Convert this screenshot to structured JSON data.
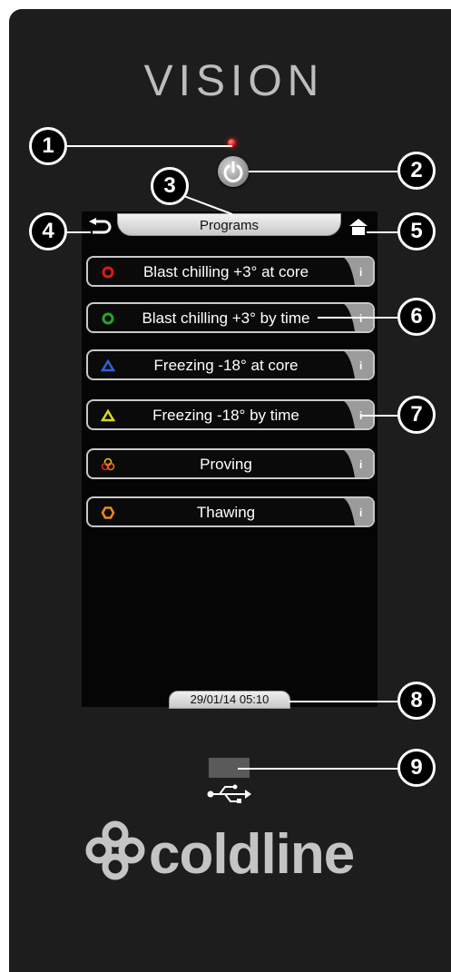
{
  "device": {
    "brand": "VISION",
    "logo_text": "coldline"
  },
  "screen": {
    "header_title": "Programs",
    "datetime": "29/01/14  05:10",
    "programs": [
      {
        "label": "Blast chilling +3° at core",
        "icon": "circle-red-icon",
        "color": "#e01818",
        "info": "i"
      },
      {
        "label": "Blast chilling +3° by time",
        "icon": "circle-green-icon",
        "color": "#23a823",
        "info": "i"
      },
      {
        "label": "Freezing -18° at core",
        "icon": "triangle-blue-icon",
        "color": "#2f62d8",
        "info": "i"
      },
      {
        "label": "Freezing -18° by time",
        "icon": "triangle-yellow-icon",
        "color": "#d8d81a",
        "info": "i"
      },
      {
        "label": "Proving",
        "icon": "proving-rings-icon",
        "color": "#f0a010",
        "info": "i"
      },
      {
        "label": "Thawing",
        "icon": "hexagon-orange-icon",
        "color": "#f08818",
        "info": "i"
      }
    ]
  },
  "callouts": [
    "1",
    "2",
    "3",
    "4",
    "5",
    "6",
    "7",
    "8",
    "9"
  ]
}
